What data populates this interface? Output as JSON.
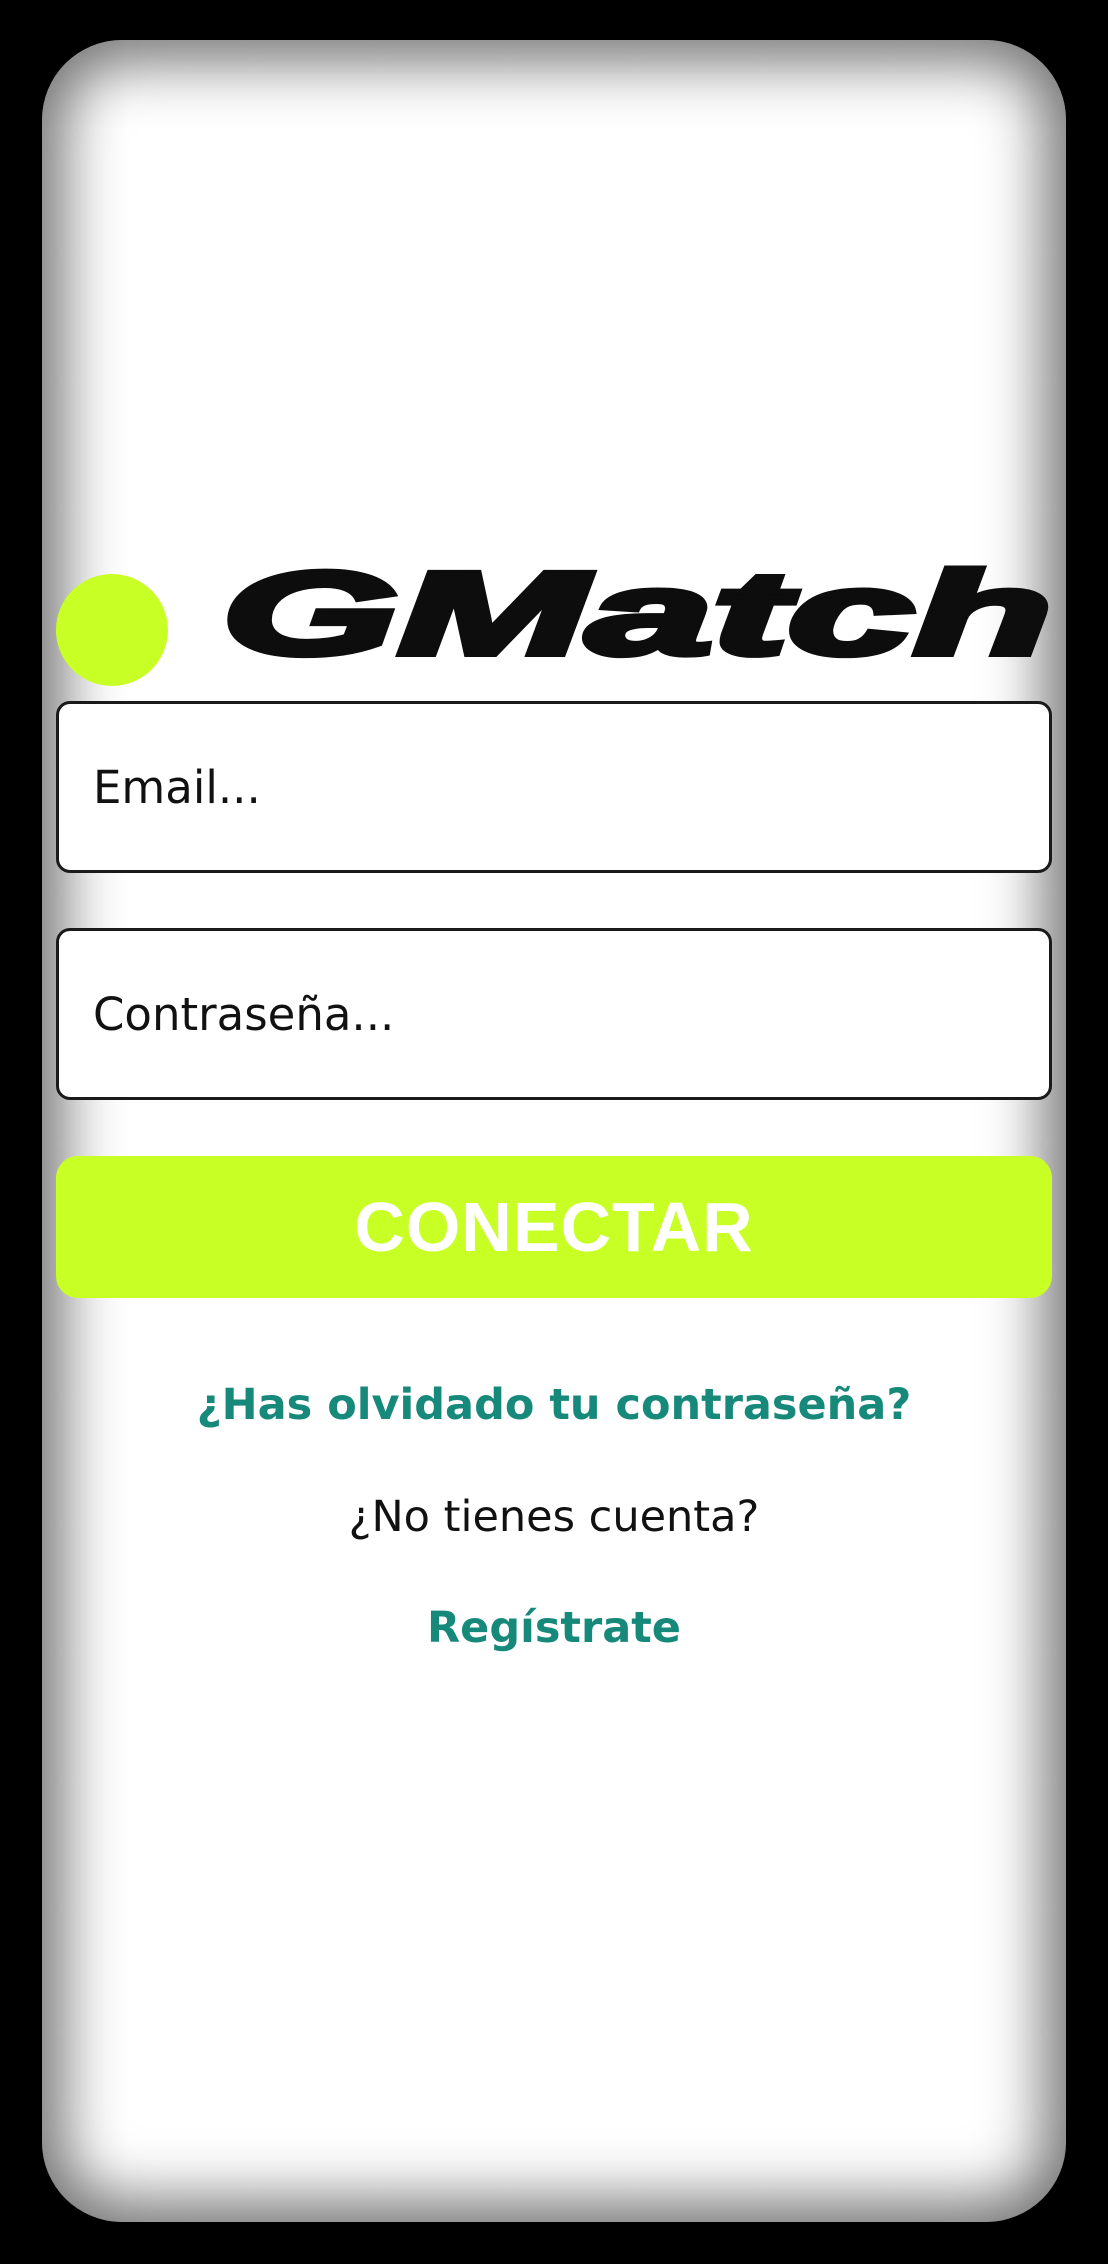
{
  "logo": {
    "wordmark": "GMatch",
    "dot_color": "#c8ff24"
  },
  "form": {
    "email_placeholder": "Email...",
    "email_value": "",
    "password_placeholder": "Contraseña...",
    "password_value": "",
    "connect_label": "CONECTAR"
  },
  "links": {
    "forgot_password": "¿Has olvidado tu contraseña?",
    "no_account_text": "¿No tienes cuenta?",
    "register": "Regístrate"
  },
  "colors": {
    "accent_lime": "#c8ff24",
    "link_teal": "#16897a",
    "border": "#1a1a1a"
  }
}
